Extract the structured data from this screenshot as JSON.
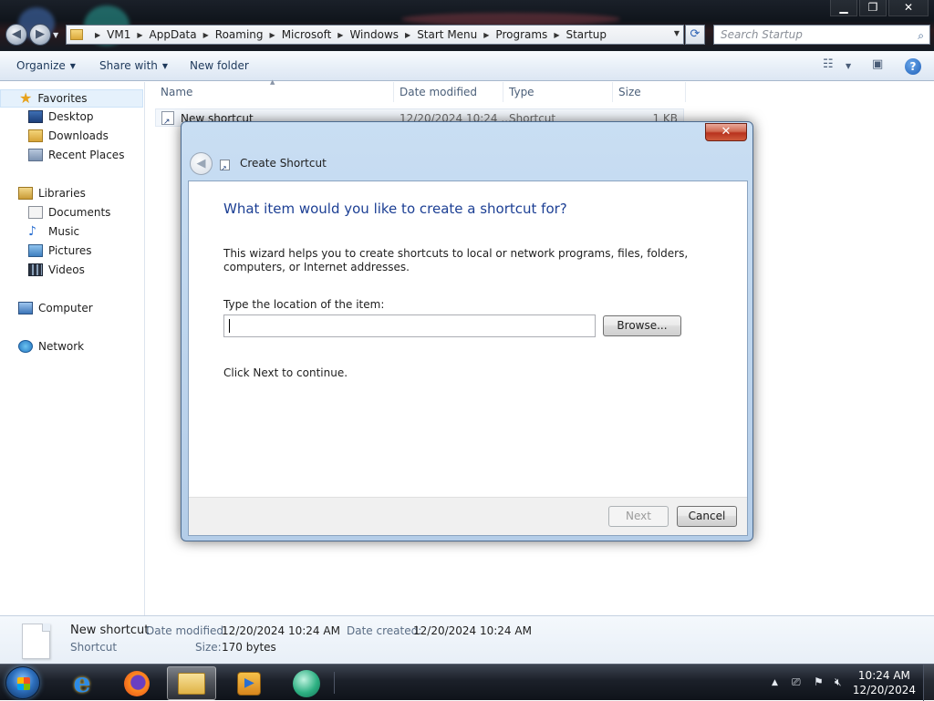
{
  "explorer": {
    "breadcrumbs": [
      "VM1",
      "AppData",
      "Roaming",
      "Microsoft",
      "Windows",
      "Start Menu",
      "Programs",
      "Startup"
    ],
    "search_placeholder": "Search Startup",
    "window_controls": {
      "minimize": "▁",
      "maximize": "❐",
      "close": "✕"
    }
  },
  "toolbar": {
    "organize": "Organize",
    "share_with": "Share with",
    "new_folder": "New folder",
    "views_icon": "view-menu-icon",
    "preview_icon": "preview-pane-icon",
    "help": "?"
  },
  "navigation": {
    "favorites": "Favorites",
    "desktop": "Desktop",
    "downloads": "Downloads",
    "recent_places": "Recent Places",
    "libraries": "Libraries",
    "documents": "Documents",
    "music": "Music",
    "pictures": "Pictures",
    "videos": "Videos",
    "computer": "Computer",
    "network": "Network"
  },
  "file_list": {
    "columns": {
      "name": "Name",
      "date_modified": "Date modified",
      "type": "Type",
      "size": "Size"
    },
    "rows": [
      {
        "name": "New shortcut",
        "date_modified": "12/20/2024 10:24 ...",
        "type": "Shortcut",
        "size": "1 KB"
      }
    ]
  },
  "details": {
    "name": "New shortcut",
    "type": "Shortcut",
    "date_modified_label": "Date modified:",
    "date_modified": "12/20/2024 10:24 AM",
    "date_created_label": "Date created:",
    "date_created": "12/20/2024 10:24 AM",
    "size_label": "Size:",
    "size": "170 bytes"
  },
  "dialog": {
    "title": "Create Shortcut",
    "close": "✕",
    "heading": "What item would you like to create a shortcut for?",
    "intro": "This wizard helps you to create shortcuts to local or network programs, files, folders, computers, or Internet addresses.",
    "location_label": "Type the location of the item:",
    "location_value": "",
    "browse": "Browse...",
    "continue_text": "Click Next to continue.",
    "next": "Next",
    "cancel": "Cancel"
  },
  "taskbar": {
    "time": "10:24 AM",
    "date": "12/20/2024",
    "ie_glyph": "e",
    "tray_arrow": "▲"
  },
  "colors": {
    "heading_blue": "#1c3f94",
    "toolbar_text": "#1e395b",
    "close_red": "#c8432b"
  }
}
